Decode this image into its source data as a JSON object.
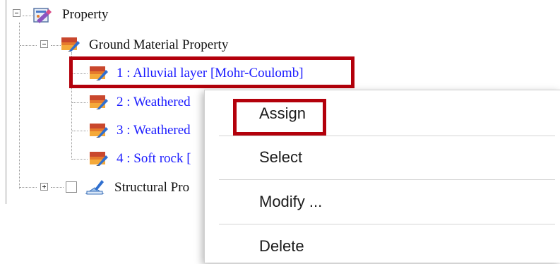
{
  "tree": {
    "root": {
      "label": "Property",
      "expanded": true,
      "icon": "property-icon"
    },
    "ground_material": {
      "label": "Ground Material Property",
      "expanded": true,
      "icon": "material-icon"
    },
    "materials": [
      {
        "label": "1 : Alluvial layer [Mohr-Coulomb]",
        "icon": "material-icon"
      },
      {
        "label": "2 : Weathered",
        "icon": "material-icon"
      },
      {
        "label": "3 : Weathered",
        "icon": "material-icon"
      },
      {
        "label": "4 : Soft rock [",
        "icon": "material-icon"
      }
    ],
    "structural": {
      "label": "Structural Pro",
      "expanded": false,
      "checked": false,
      "icon": "structural-icon"
    }
  },
  "context_menu": {
    "items": [
      "Assign",
      "Select",
      "Modify ...",
      "Delete"
    ]
  },
  "colors": {
    "highlight": "#b3000b",
    "material_label": "#1a1aff",
    "text": "#111111"
  }
}
